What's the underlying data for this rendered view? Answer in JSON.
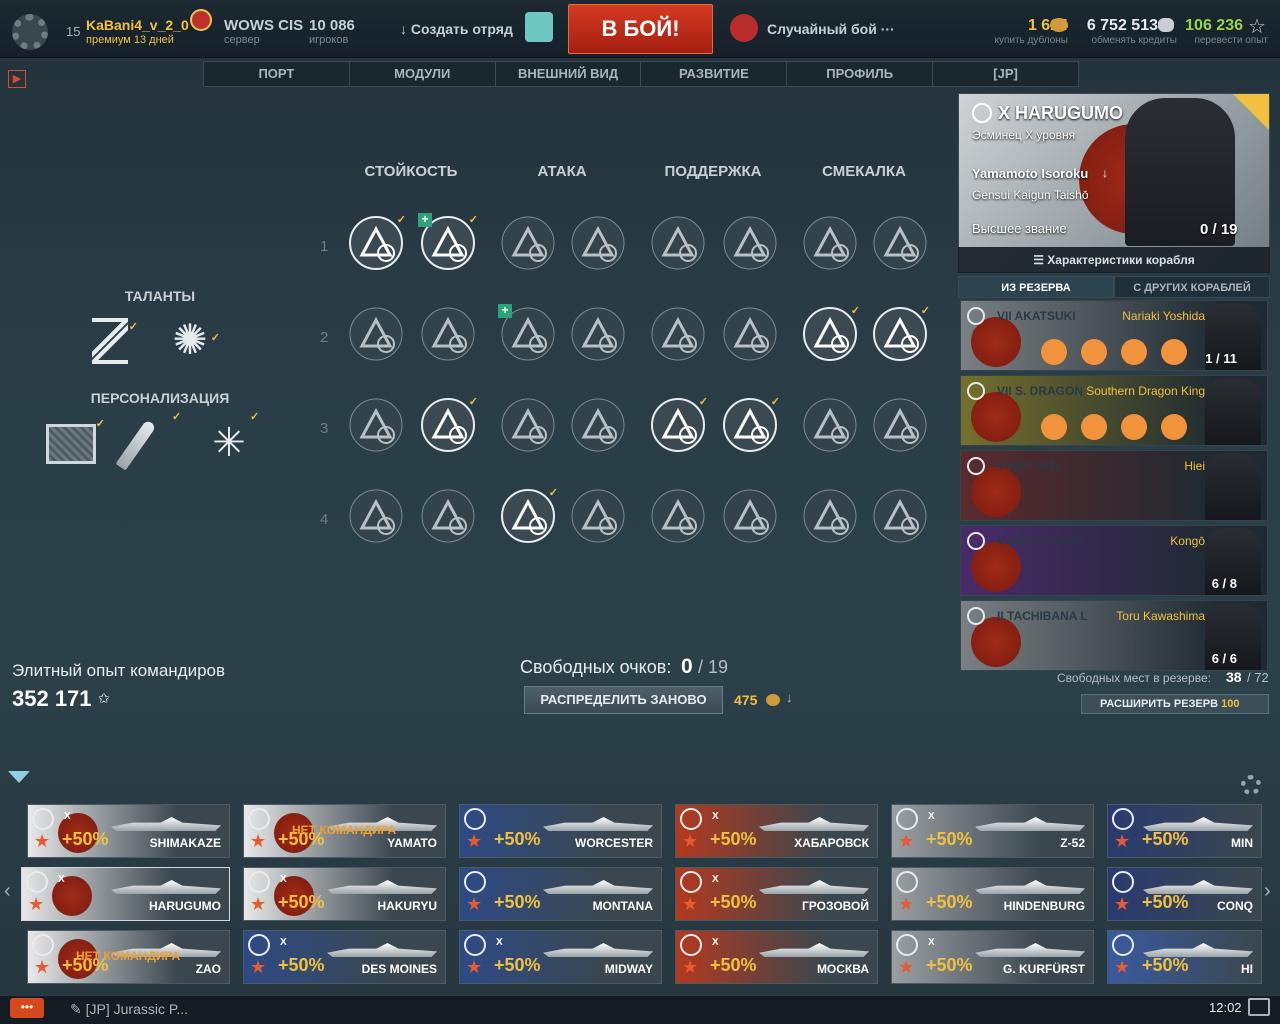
{
  "header": {
    "level": "15",
    "username": "KaBani4_v_2_0",
    "premium": "премиум 13 дней",
    "server_name": "WOWS CIS",
    "server_label": "сервер",
    "players": "10 086",
    "players_label": "игроков",
    "create_squad": "Создать отряд",
    "battle": "В БОЙ!",
    "mode": "Случайный бой",
    "mode_more": "···",
    "doubloons": "1 624",
    "doubloons_label": "купить дублоны",
    "credits": "6 752 513",
    "credits_label": "обменять кредиты",
    "free_xp": "106 236",
    "free_xp_label": "перевести опыт"
  },
  "nav": [
    "ПОРТ",
    "МОДУЛИ",
    "ВНЕШНИЙ ВИД",
    "РАЗВИТИЕ",
    "ПРОФИЛЬ",
    "[JP]"
  ],
  "skills": {
    "columns": [
      "СТОЙКОСТЬ",
      "АТАКА",
      "ПОДДЕРЖКА",
      "СМЕКАЛКА"
    ],
    "rows": [
      "1",
      "2",
      "3",
      "4"
    ]
  },
  "talents": {
    "title": "ТАЛАНТЫ",
    "personal": "ПЕРСОНАЛИЗАЦИЯ"
  },
  "commander": {
    "ship": "X HARUGUMO",
    "ship_class": "Эсминец X уровня",
    "name": "Yamamoto Isoroku",
    "rank_jp": "Gensui Kaigun Taishō",
    "rank": "Высшее звание",
    "points": "0 / 19",
    "stats_btn": "Характеристики корабля"
  },
  "reserve": {
    "tab_reserve": "ИЗ РЕЗЕРВА",
    "tab_other": "С ДРУГИХ КОРАБЛЕЙ",
    "items": [
      {
        "ship": "VII AKATSUKI",
        "name": "Nariaki Yoshida",
        "pts": "1 / 11",
        "bg": "#7a8084"
      },
      {
        "ship": "VII S. DRAGON",
        "name": "Southern Dragon King",
        "pts": "",
        "bg": "#75702c"
      },
      {
        "ship": "V ARP HIEI",
        "name": "Hiei",
        "pts": "",
        "bg": "#5a2a2e"
      },
      {
        "ship": "V ARP KONGŌ",
        "name": "Kongō",
        "pts": "6 / 8",
        "bg": "#4a2a6a"
      },
      {
        "ship": "II TACHIBANA L",
        "name": "Toru Kawashima",
        "pts": "6 / 6",
        "bg": "#7a8084"
      }
    ],
    "free_slots_label": "Свободных мест в резерве:",
    "free_slots": "38",
    "slots_total": "/ 72",
    "expand": "РАСШИРИТЬ РЕЗЕРВ",
    "expand_cost": "100"
  },
  "elite": {
    "label": "Элитный опыт командиров",
    "value": "352 171"
  },
  "free_points": {
    "label": "Свободных очков:",
    "value": "0",
    "total": "/ 19",
    "redistribute": "РАСПРЕДЕЛИТЬ ЗАНОВО",
    "cost": "475"
  },
  "ships": [
    [
      {
        "name": "SHIMAKAZE",
        "pct": "+50%",
        "tier": "X",
        "flag": "jp"
      },
      {
        "name": "YAMATO",
        "pct": "+50%",
        "tier": "",
        "flag": "jp",
        "nocmd": "НЕТ КОМАНДИРА"
      },
      {
        "name": "WORCESTER",
        "pct": "+50%",
        "tier": "",
        "flag": "us"
      },
      {
        "name": "ХАБАРОВСК",
        "pct": "+50%",
        "tier": "X",
        "flag": "ru"
      },
      {
        "name": "Z-52",
        "pct": "+50%",
        "tier": "X",
        "flag": "de"
      },
      {
        "name": "MIN",
        "pct": "+50%",
        "tier": "",
        "flag": "uk"
      }
    ],
    [
      {
        "name": "HARUGUMO",
        "pct": "",
        "tier": "X",
        "flag": "jp"
      },
      {
        "name": "HAKURYU",
        "pct": "+50%",
        "tier": "X",
        "flag": "jp"
      },
      {
        "name": "MONTANA",
        "pct": "+50%",
        "tier": "",
        "flag": "us"
      },
      {
        "name": "ГРОЗОВОЙ",
        "pct": "+50%",
        "tier": "X",
        "flag": "ru"
      },
      {
        "name": "HINDENBURG",
        "pct": "+50%",
        "tier": "",
        "flag": "de"
      },
      {
        "name": "CONQ",
        "pct": "+50%",
        "tier": "",
        "flag": "uk"
      }
    ],
    [
      {
        "name": "ZAO",
        "pct": "+50%",
        "tier": "",
        "flag": "jp",
        "nocmd": "НЕТ КОМАНДИРА"
      },
      {
        "name": "DES MOINES",
        "pct": "+50%",
        "tier": "X",
        "flag": "us"
      },
      {
        "name": "MIDWAY",
        "pct": "+50%",
        "tier": "X",
        "flag": "us"
      },
      {
        "name": "МОСКВА",
        "pct": "+50%",
        "tier": "X",
        "flag": "ru"
      },
      {
        "name": "G. KURFÜRST",
        "pct": "+50%",
        "tier": "X",
        "flag": "de"
      },
      {
        "name": "HI",
        "pct": "+50%",
        "tier": "",
        "flag": "fr"
      }
    ]
  ],
  "footer": {
    "chat_tab": "[JP] Jurassic P...",
    "time": "12:02",
    "chat_btn": "•••"
  },
  "colors": {
    "accent": "#f0c040",
    "battle": "#c72b16",
    "skill_bg": "#8a9599"
  }
}
